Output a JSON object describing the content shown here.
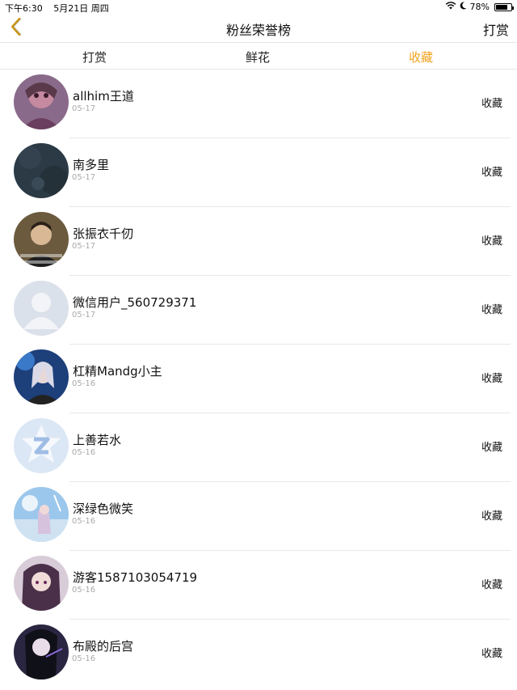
{
  "status_bar": {
    "time": "下午6:30",
    "date": "5月21日 周四",
    "battery": "78%",
    "battery_level": 0.78,
    "icons": [
      "wifi-icon",
      "moon-icon",
      "battery-icon"
    ]
  },
  "nav": {
    "title": "粉丝荣誉榜",
    "right_label": "打赏",
    "back_icon": "chevron-left-icon",
    "accent_color": "#f0a21e"
  },
  "tabs": [
    {
      "label": "打赏",
      "active": false
    },
    {
      "label": "鲜花",
      "active": false
    },
    {
      "label": "收藏",
      "active": true
    }
  ],
  "fans": [
    {
      "name": "allhim王道",
      "date": "05-17",
      "action": "收藏",
      "avatar": "anime-girl-avatar"
    },
    {
      "name": "南多里",
      "date": "05-17",
      "action": "收藏",
      "avatar": "dark-texture-avatar"
    },
    {
      "name": "张振衣千仞",
      "date": "05-17",
      "action": "收藏",
      "avatar": "photo-person-avatar"
    },
    {
      "name": "微信用户_560729371",
      "date": "05-17",
      "action": "收藏",
      "avatar": "default-user-avatar"
    },
    {
      "name": "杠精Mandg小主",
      "date": "05-16",
      "action": "收藏",
      "avatar": "anime-blue-avatar"
    },
    {
      "name": "上善若水",
      "date": "05-16",
      "action": "收藏",
      "avatar": "qq-logo-avatar"
    },
    {
      "name": "深绿色微笑",
      "date": "05-16",
      "action": "收藏",
      "avatar": "sky-scene-avatar"
    },
    {
      "name": "游客1587103054719",
      "date": "05-16",
      "action": "收藏",
      "avatar": "anime-purple-avatar"
    },
    {
      "name": "布殿的后宫",
      "date": "05-16",
      "action": "收藏",
      "avatar": "anime-dark-avatar"
    }
  ]
}
